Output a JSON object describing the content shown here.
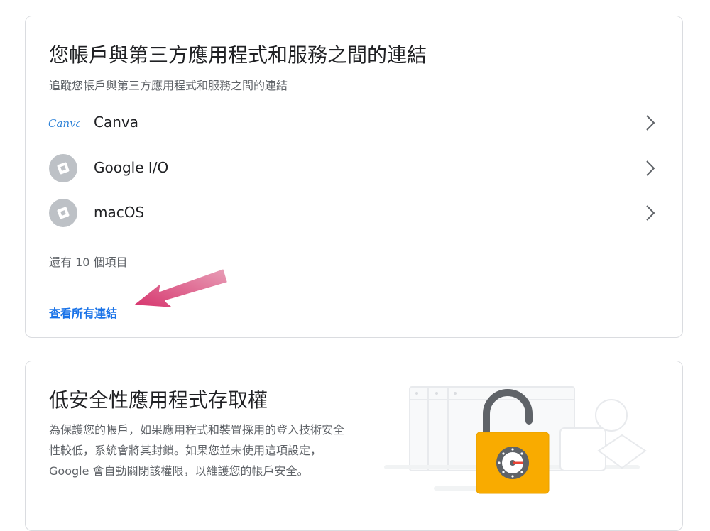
{
  "connections_card": {
    "title": "您帳戶與第三方應用程式和服務之間的連結",
    "subtitle": "追蹤您帳戶與第三方應用程式和服務之間的連結",
    "items": [
      {
        "label": "Canva",
        "logo": "canva-logo",
        "logo_text": "Canva"
      },
      {
        "label": "Google I/O",
        "logo": "generic-app-icon"
      },
      {
        "label": "macOS",
        "logo": "generic-app-icon"
      }
    ],
    "more_count": "還有 10 個項目",
    "view_all_label": "查看所有連結"
  },
  "less_secure_card": {
    "title": "低安全性應用程式存取權",
    "description": "為保護您的帳戶，如果應用程式和裝置採用的登入技術安全性較低，系統會將其封鎖。如果您並未使用這項設定，Google 會自動關閉該權限，以維護您的帳戶安全。",
    "illustration": "unlocked-padlock-illustration"
  },
  "annotation": {
    "icon": "pink-arrow-pointer",
    "color": "#d6336c"
  },
  "colors": {
    "link": "#1a73e8",
    "padlock": "#f9ab00",
    "text_secondary": "#5f6368"
  }
}
